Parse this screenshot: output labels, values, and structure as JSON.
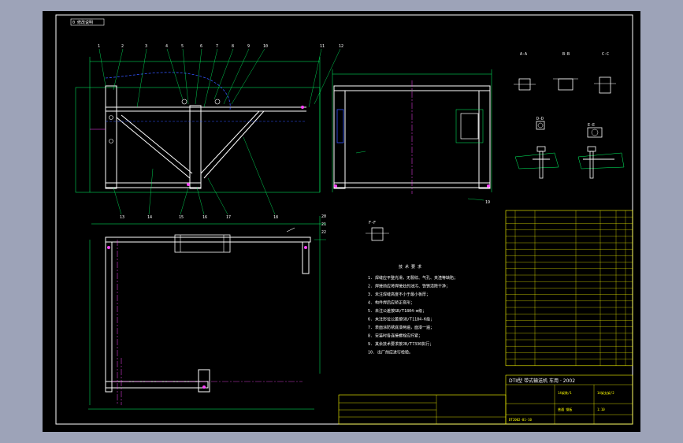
{
  "sheet": {
    "title_block": {
      "title_cell": "DTⅡ型 带式输送机 车用 · 2002",
      "drawing_no": "DT2002-01-10",
      "part_name": "14架装/1",
      "sub_part": "14架支架/2",
      "material": "普通 钢板",
      "scale": "1:10"
    },
    "corner_tag": "0 修改说明",
    "section_labels": [
      "A-A",
      "B-B",
      "C-C",
      "D-D",
      "E-E",
      "F-F"
    ],
    "tech_requirements": {
      "heading": "技 术 要 求",
      "items": [
        "1. 焊缝应平整光滑，无裂纹、气孔、夹渣等缺陷；",
        "2. 焊接前应将焊接处的油污、铁锈清除干净；",
        "3. 未注焊缝高度不小于最小板厚；",
        "4. 构件焊后应矫正变形；",
        "5. 未注公差按GB/T1804-m级；",
        "6. 未注形位公差按GB/T1184-K级；",
        "7. 表面涂防锈底漆两遍，面漆一遍；",
        "8. 安装时各连接螺栓应拧紧；",
        "9. 其余技术要求按JB/T7330执行；",
        "10. 出厂前应进行检验。"
      ]
    },
    "part_numbers_top": [
      "1",
      "2",
      "3",
      "4",
      "5",
      "6",
      "7",
      "8",
      "9",
      "10",
      "11",
      "12"
    ],
    "part_numbers_bottom": [
      "13",
      "14",
      "15",
      "16",
      "17",
      "18",
      "19",
      "20",
      "21",
      "22"
    ],
    "parts_list_rows": 24,
    "colors": {
      "background": "#000000",
      "frame": "#ffffff",
      "geometry": "#ffffff",
      "dimension": "#00ff66",
      "hidden": "#3355ff",
      "center": "#ff44ff",
      "table": "#ffff00"
    }
  }
}
